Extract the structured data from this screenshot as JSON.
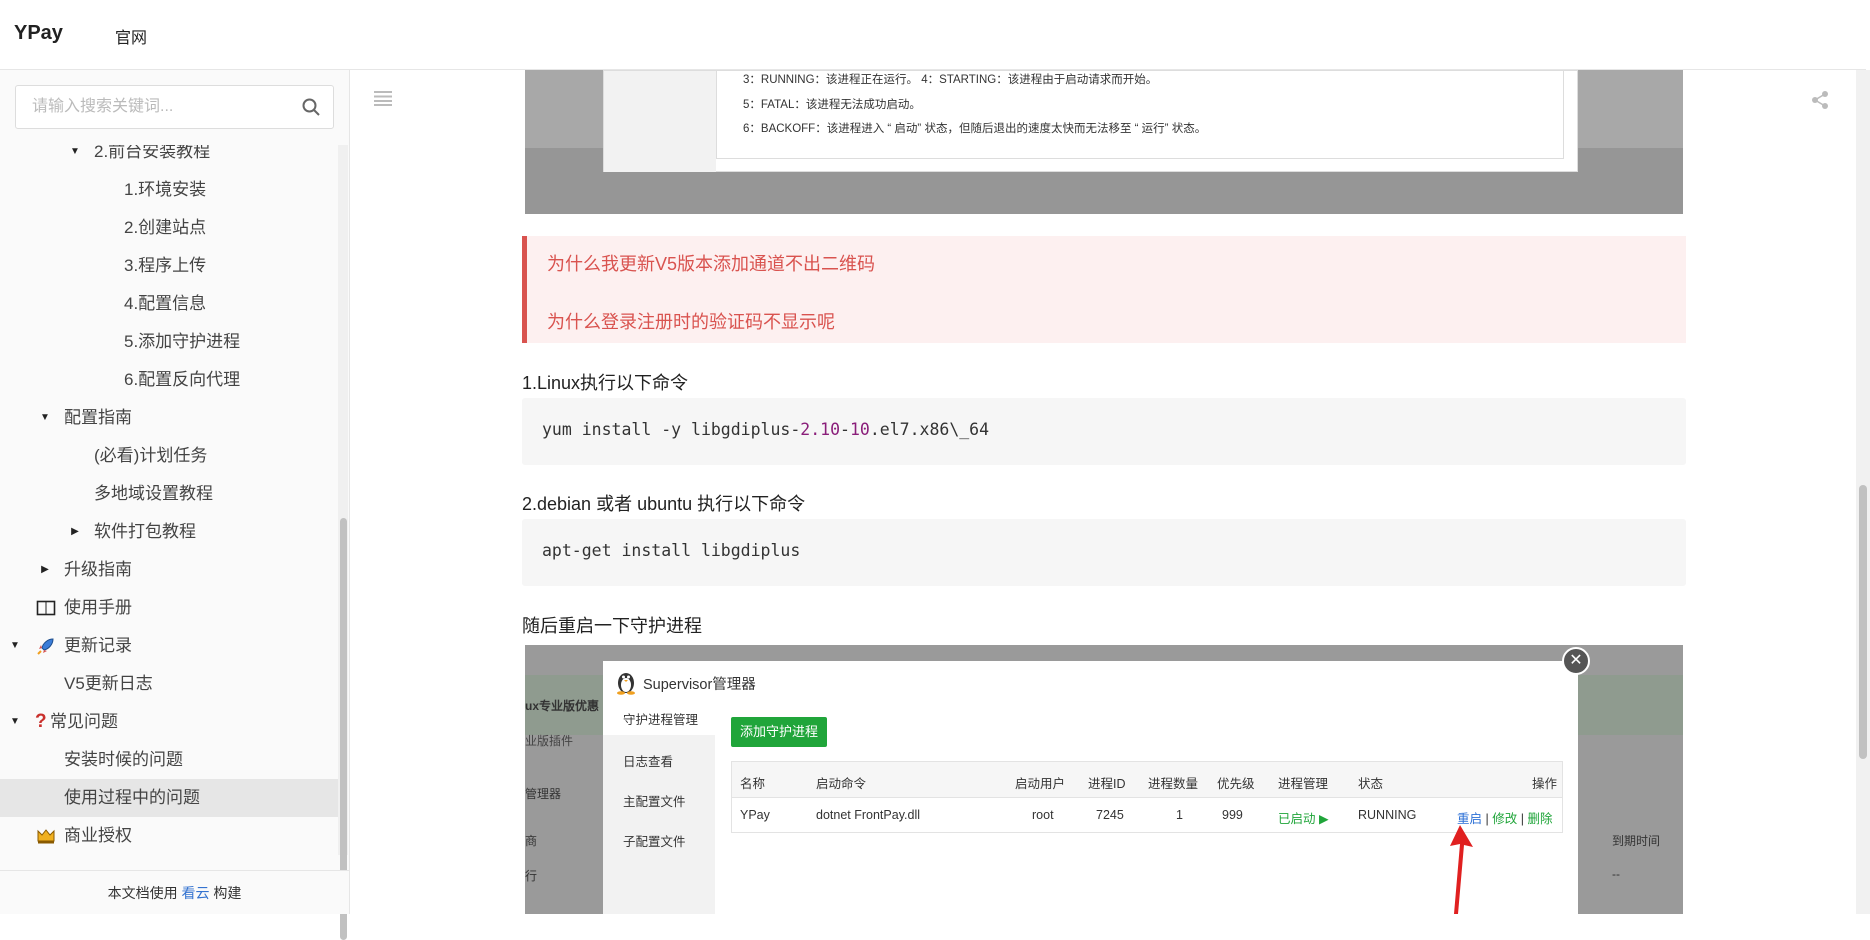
{
  "header": {
    "logo": "YPay",
    "link": "官网"
  },
  "search": {
    "placeholder": "请输入搜索关键词..."
  },
  "sidebar": {
    "items": [
      {
        "label": "2.前台安装教程"
      },
      {
        "label": "1.环境安装"
      },
      {
        "label": "2.创建站点"
      },
      {
        "label": "3.程序上传"
      },
      {
        "label": "4.配置信息"
      },
      {
        "label": "5.添加守护进程"
      },
      {
        "label": "6.配置反向代理"
      },
      {
        "label": "配置指南"
      },
      {
        "label": "(必看)计划任务"
      },
      {
        "label": "多地域设置教程"
      },
      {
        "label": "软件打包教程"
      },
      {
        "label": "升级指南"
      },
      {
        "label": "使用手册"
      },
      {
        "label": "更新记录"
      },
      {
        "label": "V5更新日志"
      },
      {
        "label": "常见问题"
      },
      {
        "label": "安装时候的问题"
      },
      {
        "label": "使用过程中的问题"
      },
      {
        "label": "商业授权"
      }
    ],
    "footer": {
      "prefix": "本文档使用",
      "link": "看云",
      "suffix": "构建"
    }
  },
  "screenshot_top": {
    "lines": [
      "3：RUNNING：该进程正在运行。 4：STARTING：该进程由于启动请求而开始。",
      "5：FATAL：该进程无法成功启动。",
      "6：BACKOFF：该进程进入 “ 启动” 状态，但随后退出的速度太快而无法移至 “ 运行” 状态。"
    ]
  },
  "notice": {
    "q1": "为什么我更新V5版本添加通道不出二维码",
    "q2": "为什么登录注册时的验证码不显示呢"
  },
  "content": {
    "h1": "1.Linux执行以下命令",
    "code1_a": "yum install -y libgdiplus-",
    "code1_b": "2.10",
    "code1_c": "-",
    "code1_d": "10",
    "code1_e": ".el7.x86\\_64",
    "h2": "2.debian 或者 ubuntu 执行以下命令",
    "code2": "apt-get install libgdiplus",
    "h3": "随后重启一下守护进程"
  },
  "screenshot_bottom": {
    "bg": {
      "t1": "ux专业版优惠",
      "t2": "业版插件",
      "t3": "管理器",
      "t4": "商",
      "t5": "到期时间",
      "t6": "--",
      "t7": "行"
    },
    "title": "Supervisor管理器",
    "side": [
      "守护进程管理",
      "日志查看",
      "主配置文件",
      "子配置文件"
    ],
    "add_button": "添加守护进程",
    "headers": [
      "名称",
      "启动命令",
      "启动用户",
      "进程ID",
      "进程数量",
      "优先级",
      "进程管理",
      "状态",
      "操作"
    ],
    "row": {
      "name": "YPay",
      "cmd": "dotnet FrontPay.dll",
      "user": "root",
      "pid": "7245",
      "count": "1",
      "priority": "999",
      "manage": "已启动 ▶",
      "status": "RUNNING",
      "op_restart": "重启",
      "op_sep1": " | ",
      "op_edit": "修改",
      "op_sep2": " | ",
      "op_delete": "删除"
    },
    "close_glyph": "✕"
  },
  "colors": {
    "accent_red": "#d9534f",
    "green": "#20a53a",
    "link_blue": "#3473d0"
  },
  "icons": {
    "search": "search-icon",
    "menu": "list-icon",
    "share": "share-icon",
    "book": "book-icon",
    "rocket": "rocket-icon",
    "question": "question-icon",
    "crown": "crown-icon"
  }
}
